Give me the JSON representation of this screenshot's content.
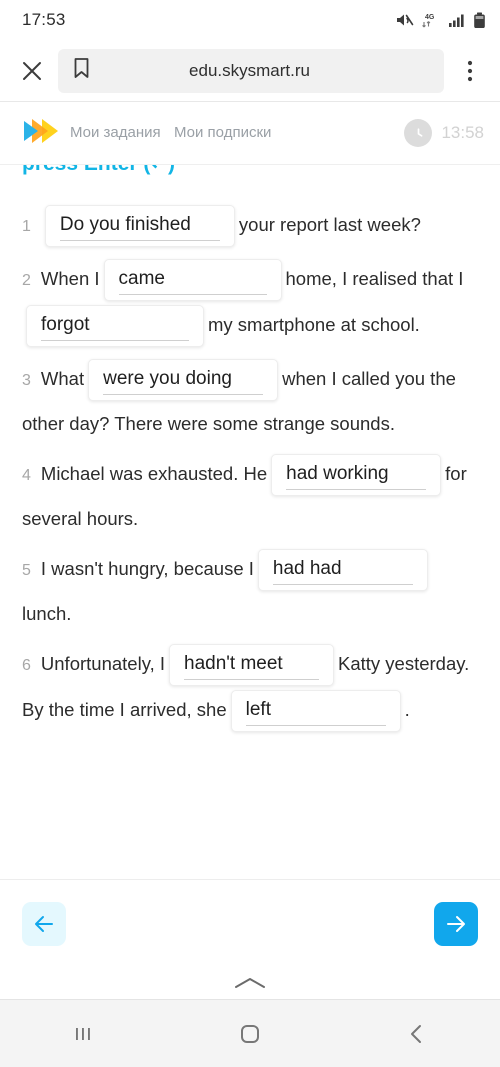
{
  "status_bar": {
    "time": "17:53",
    "icons": [
      "mute-icon",
      "4g-data-icon",
      "signal-bars-icon",
      "battery-icon"
    ],
    "network_label": "4G"
  },
  "browser": {
    "close_label": "×",
    "url": "edu.skysmart.ru",
    "icons": [
      "close-icon",
      "bookmark-icon",
      "overflow-menu-icon"
    ]
  },
  "site_header": {
    "logo_name": "skysmart-logo",
    "logo_colors": {
      "blue": "#2bb3e8",
      "yellow": "#ffd21e",
      "orange": "#ffa41b"
    },
    "tabs": [
      {
        "label": "Мои задания"
      },
      {
        "label": "Мои подписки"
      }
    ],
    "timer": "13:58"
  },
  "exercise": {
    "hint": "press Enter (↵)",
    "items": [
      {
        "number": "1",
        "before": "",
        "answer": "Do you finished",
        "after": "your report last week?",
        "width_class": "w-lg"
      },
      {
        "number": "2",
        "before": "When I",
        "answer": "came",
        "mid": "home, I realised that I",
        "answer2": "forgot",
        "after": "my smartphone at school.",
        "width_class": "w-md"
      },
      {
        "number": "3",
        "before": "What",
        "answer": "were you doing",
        "after": "when I called you the other day? There were some strange sounds.",
        "width_class": "w-lg"
      },
      {
        "number": "4",
        "before": "Michael was exhausted. He",
        "answer": "had working",
        "after": "for several hours.",
        "width_class": "w-sm"
      },
      {
        "number": "5",
        "before": "I wasn't hungry, because I",
        "answer": "had had",
        "after": "lunch.",
        "width_class": "w-sm"
      },
      {
        "number": "6",
        "before": "Unfortunately, I",
        "answer": "hadn't meet",
        "mid": "Katty yesterday. By the time I arrived, she",
        "answer2": "left",
        "after": ".",
        "width_class": "w-xl"
      }
    ]
  },
  "footer": {
    "prev_icon": "arrow-left-icon",
    "next_icon": "arrow-right-icon",
    "prev_color": "#11a7ec",
    "next_bg": "#11a7ec"
  },
  "android_nav": {
    "buttons": [
      "recents-icon",
      "home-icon",
      "back-icon"
    ]
  }
}
